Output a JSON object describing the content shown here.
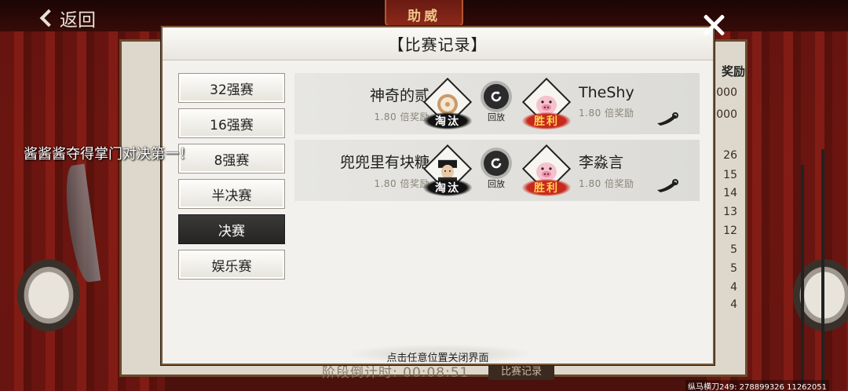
{
  "background": {
    "back_label": "返回",
    "banner_text": "助威",
    "right_column_header": "奖励",
    "right_column_values": [
      "000",
      "000",
      "26",
      "15",
      "14",
      "13",
      "12",
      "5",
      "5",
      "4",
      "4"
    ],
    "footer_text": "阶段倒计时: 00:08:51",
    "footer_button": "比赛记录",
    "watermark": "纵马横刀249: 278899326 11262051"
  },
  "modal": {
    "title": "【比赛记录】",
    "close_hint": "点击任意位置关闭界面"
  },
  "tabs": [
    {
      "label": "32强赛",
      "active": false
    },
    {
      "label": "16强赛",
      "active": false
    },
    {
      "label": "8强赛",
      "active": false
    },
    {
      "label": "半决赛",
      "active": false
    },
    {
      "label": "决赛",
      "active": true
    },
    {
      "label": "娱乐赛",
      "active": false
    }
  ],
  "matches": [
    {
      "left_name": "神奇的贰",
      "left_reward": "1.80 倍奖励",
      "left_result": "淘汰",
      "left_avatar": "flower-avatar",
      "replay_label": "回放",
      "right_name": "TheShy",
      "right_reward": "1.80 倍奖励",
      "right_result": "胜利",
      "right_avatar": "pig-avatar"
    },
    {
      "left_name": "兜兜里有块糖",
      "left_reward": "1.80 倍奖励",
      "left_result": "淘汰",
      "left_avatar": "swordsman-avatar",
      "replay_label": "回放",
      "right_name": "李淼言",
      "right_reward": "1.80 倍奖励",
      "right_result": "胜利",
      "right_avatar": "pig-avatar"
    }
  ],
  "marquee": "酱酱酱夺得掌门对决第一！",
  "colors": {
    "active_tab": "#2f2d2b",
    "win_badge": "#c8281e",
    "lose_badge": "#111111",
    "panel_bg": "#f2f1ee"
  }
}
